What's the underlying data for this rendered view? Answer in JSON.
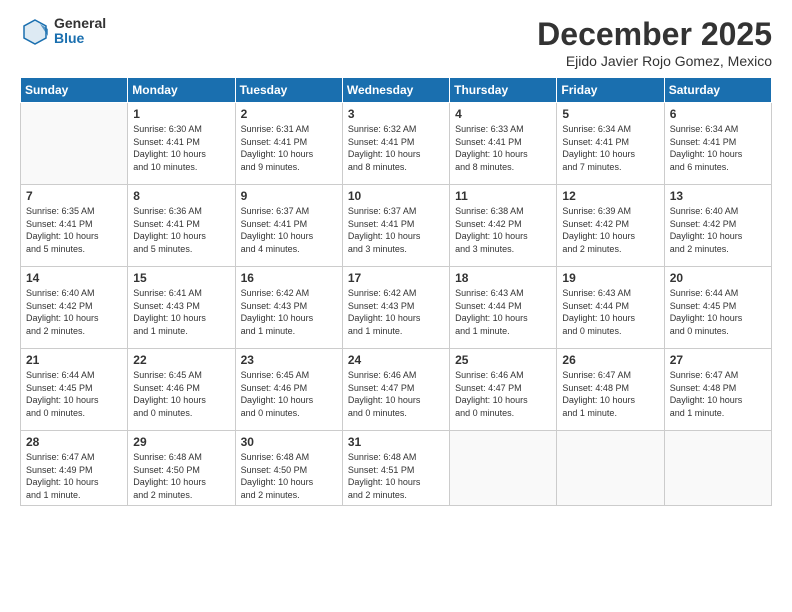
{
  "logo": {
    "general": "General",
    "blue": "Blue"
  },
  "header": {
    "month": "December 2025",
    "location": "Ejido Javier Rojo Gomez, Mexico"
  },
  "weekdays": [
    "Sunday",
    "Monday",
    "Tuesday",
    "Wednesday",
    "Thursday",
    "Friday",
    "Saturday"
  ],
  "weeks": [
    [
      {
        "day": "",
        "info": ""
      },
      {
        "day": "1",
        "info": "Sunrise: 6:30 AM\nSunset: 4:41 PM\nDaylight: 10 hours\nand 10 minutes."
      },
      {
        "day": "2",
        "info": "Sunrise: 6:31 AM\nSunset: 4:41 PM\nDaylight: 10 hours\nand 9 minutes."
      },
      {
        "day": "3",
        "info": "Sunrise: 6:32 AM\nSunset: 4:41 PM\nDaylight: 10 hours\nand 8 minutes."
      },
      {
        "day": "4",
        "info": "Sunrise: 6:33 AM\nSunset: 4:41 PM\nDaylight: 10 hours\nand 8 minutes."
      },
      {
        "day": "5",
        "info": "Sunrise: 6:34 AM\nSunset: 4:41 PM\nDaylight: 10 hours\nand 7 minutes."
      },
      {
        "day": "6",
        "info": "Sunrise: 6:34 AM\nSunset: 4:41 PM\nDaylight: 10 hours\nand 6 minutes."
      }
    ],
    [
      {
        "day": "7",
        "info": "Sunrise: 6:35 AM\nSunset: 4:41 PM\nDaylight: 10 hours\nand 5 minutes."
      },
      {
        "day": "8",
        "info": "Sunrise: 6:36 AM\nSunset: 4:41 PM\nDaylight: 10 hours\nand 5 minutes."
      },
      {
        "day": "9",
        "info": "Sunrise: 6:37 AM\nSunset: 4:41 PM\nDaylight: 10 hours\nand 4 minutes."
      },
      {
        "day": "10",
        "info": "Sunrise: 6:37 AM\nSunset: 4:41 PM\nDaylight: 10 hours\nand 3 minutes."
      },
      {
        "day": "11",
        "info": "Sunrise: 6:38 AM\nSunset: 4:42 PM\nDaylight: 10 hours\nand 3 minutes."
      },
      {
        "day": "12",
        "info": "Sunrise: 6:39 AM\nSunset: 4:42 PM\nDaylight: 10 hours\nand 2 minutes."
      },
      {
        "day": "13",
        "info": "Sunrise: 6:40 AM\nSunset: 4:42 PM\nDaylight: 10 hours\nand 2 minutes."
      }
    ],
    [
      {
        "day": "14",
        "info": "Sunrise: 6:40 AM\nSunset: 4:42 PM\nDaylight: 10 hours\nand 2 minutes."
      },
      {
        "day": "15",
        "info": "Sunrise: 6:41 AM\nSunset: 4:43 PM\nDaylight: 10 hours\nand 1 minute."
      },
      {
        "day": "16",
        "info": "Sunrise: 6:42 AM\nSunset: 4:43 PM\nDaylight: 10 hours\nand 1 minute."
      },
      {
        "day": "17",
        "info": "Sunrise: 6:42 AM\nSunset: 4:43 PM\nDaylight: 10 hours\nand 1 minute."
      },
      {
        "day": "18",
        "info": "Sunrise: 6:43 AM\nSunset: 4:44 PM\nDaylight: 10 hours\nand 1 minute."
      },
      {
        "day": "19",
        "info": "Sunrise: 6:43 AM\nSunset: 4:44 PM\nDaylight: 10 hours\nand 0 minutes."
      },
      {
        "day": "20",
        "info": "Sunrise: 6:44 AM\nSunset: 4:45 PM\nDaylight: 10 hours\nand 0 minutes."
      }
    ],
    [
      {
        "day": "21",
        "info": "Sunrise: 6:44 AM\nSunset: 4:45 PM\nDaylight: 10 hours\nand 0 minutes."
      },
      {
        "day": "22",
        "info": "Sunrise: 6:45 AM\nSunset: 4:46 PM\nDaylight: 10 hours\nand 0 minutes."
      },
      {
        "day": "23",
        "info": "Sunrise: 6:45 AM\nSunset: 4:46 PM\nDaylight: 10 hours\nand 0 minutes."
      },
      {
        "day": "24",
        "info": "Sunrise: 6:46 AM\nSunset: 4:47 PM\nDaylight: 10 hours\nand 0 minutes."
      },
      {
        "day": "25",
        "info": "Sunrise: 6:46 AM\nSunset: 4:47 PM\nDaylight: 10 hours\nand 0 minutes."
      },
      {
        "day": "26",
        "info": "Sunrise: 6:47 AM\nSunset: 4:48 PM\nDaylight: 10 hours\nand 1 minute."
      },
      {
        "day": "27",
        "info": "Sunrise: 6:47 AM\nSunset: 4:48 PM\nDaylight: 10 hours\nand 1 minute."
      }
    ],
    [
      {
        "day": "28",
        "info": "Sunrise: 6:47 AM\nSunset: 4:49 PM\nDaylight: 10 hours\nand 1 minute."
      },
      {
        "day": "29",
        "info": "Sunrise: 6:48 AM\nSunset: 4:50 PM\nDaylight: 10 hours\nand 2 minutes."
      },
      {
        "day": "30",
        "info": "Sunrise: 6:48 AM\nSunset: 4:50 PM\nDaylight: 10 hours\nand 2 minutes."
      },
      {
        "day": "31",
        "info": "Sunrise: 6:48 AM\nSunset: 4:51 PM\nDaylight: 10 hours\nand 2 minutes."
      },
      {
        "day": "",
        "info": ""
      },
      {
        "day": "",
        "info": ""
      },
      {
        "day": "",
        "info": ""
      }
    ]
  ]
}
